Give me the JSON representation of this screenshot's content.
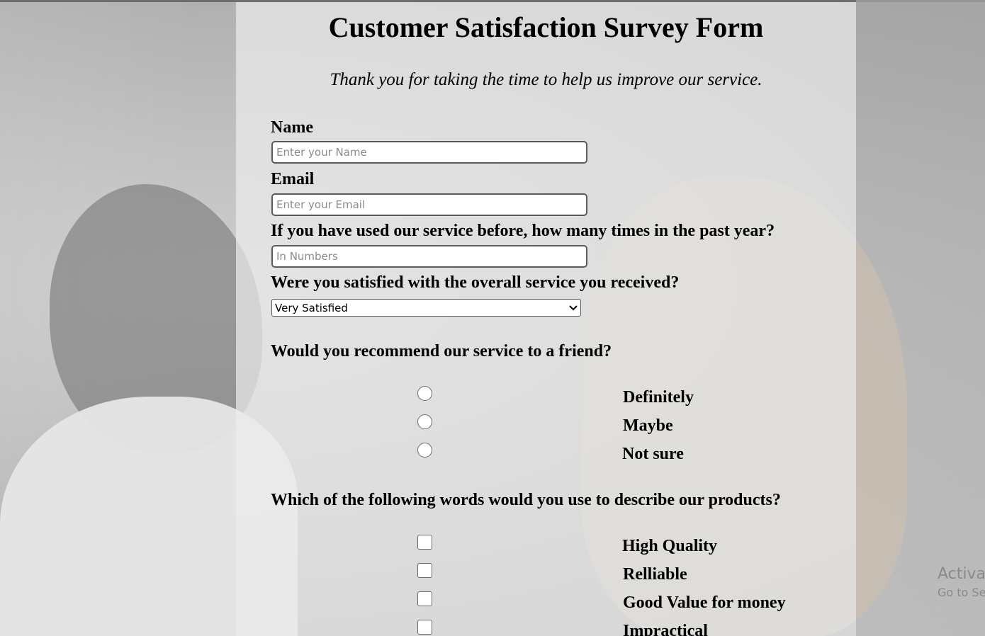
{
  "form": {
    "title": "Customer Satisfaction Survey Form",
    "subtitle": "Thank you for taking the time to help us improve our service.",
    "name": {
      "label": "Name",
      "placeholder": "Enter your Name",
      "value": ""
    },
    "email": {
      "label": "Email",
      "placeholder": "Enter your Email",
      "value": ""
    },
    "times_used": {
      "label": "If you have used our service before, how many times in the past year?",
      "placeholder": "In Numbers",
      "value": ""
    },
    "satisfaction": {
      "label": "Were you satisfied with the overall service you received?",
      "selected": "Very Satisfied"
    },
    "recommend": {
      "label": "Would you recommend our service to a friend?",
      "options": [
        "Definitely",
        "Maybe",
        "Not sure"
      ]
    },
    "describe": {
      "label": "Which of the following words would you use to describe our products?",
      "options": [
        "High Quality",
        "Relliable",
        "Good Value for money",
        "Impractical"
      ]
    }
  },
  "watermark": {
    "line1": "Activa",
    "line2": "Go to Se"
  }
}
